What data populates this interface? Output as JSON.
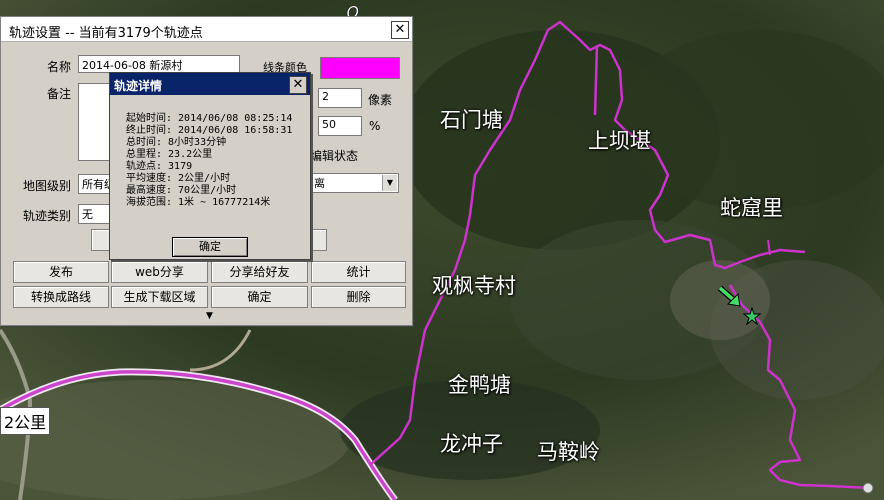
{
  "map": {
    "places": [
      "石门塘",
      "上坝堪",
      "蛇窟里",
      "观枫寺村",
      "金鸭塘",
      "龙冲子",
      "马鞍岭"
    ],
    "scale_label": "2公里",
    "colors": {
      "track": "#cc33cc",
      "road": "#cc33cc",
      "marker": "#33cc66"
    }
  },
  "settings": {
    "title": "轨迹设置 -- 当前有3179个轨迹点",
    "name_label": "名称",
    "name_value": "2014-06-08 新源村",
    "line_color_label": "线条颜色",
    "line_color": "#ff00ff",
    "note_label": "备注",
    "width_value": "2",
    "width_unit": "像素",
    "opacity_value": "50",
    "opacity_unit": "%",
    "edit_state_label": "编辑状态",
    "map_level_label": "地图级别",
    "map_level_value": "所有级",
    "distance_value": "离",
    "track_type_label": "轨迹类别",
    "track_type_value": "无",
    "buttons": {
      "publish": "发布",
      "web_share": "web分享",
      "share_friend": "分享给好友",
      "stats": "统计",
      "convert_route": "转换成路线",
      "gen_download": "生成下载区域",
      "confirm": "确定",
      "delete": "删除"
    }
  },
  "detail": {
    "title": "轨迹详情",
    "lines": [
      "起始时间: 2014/06/08 08:25:14",
      "终止时间: 2014/06/08 16:58:31",
      "总时间: 8小时33分钟",
      "总里程: 23.2公里",
      "轨迹点: 3179",
      "平均速度: 2公里/小时",
      "最高速度: 70公里/小时",
      "海拔范围: 1米 ~ 16777214米"
    ],
    "ok_label": "确定"
  }
}
